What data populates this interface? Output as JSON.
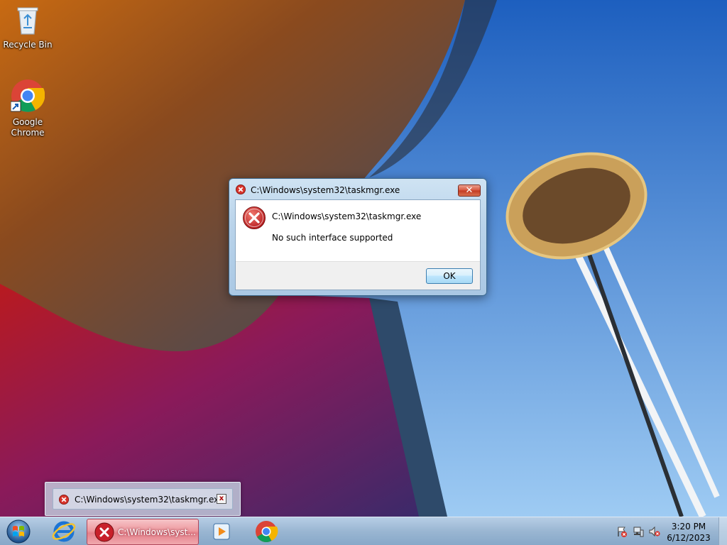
{
  "desktop": {
    "icons": [
      {
        "label": "Recycle Bin",
        "icon": "recycle-bin-icon"
      },
      {
        "label": "Google\nChrome",
        "label_line1": "Google",
        "label_line2": "Chrome",
        "icon": "chrome-icon"
      }
    ]
  },
  "dialog": {
    "title": "C:\\Windows\\system32\\taskmgr.exe",
    "close_label": "✕",
    "heading": "C:\\Windows\\system32\\taskmgr.exe",
    "message": "No such interface supported",
    "ok_label": "OK",
    "icon": "error-icon"
  },
  "peek": {
    "title": "C:\\Windows\\system32\\taskmgr.exe",
    "close_label": "x"
  },
  "taskbar": {
    "error_button_label": "C:\\Windows\\syst...",
    "items": [
      "start-orb-icon",
      "internet-explorer-icon",
      "error-icon",
      "media-player-icon",
      "chrome-icon"
    ]
  },
  "tray": {
    "time": "3:20 PM",
    "date": "6/12/2023",
    "icons": [
      "action-center-flag-icon",
      "network-icon",
      "volume-muted-icon"
    ]
  },
  "colors": {
    "error_red": "#d9342b",
    "taskbar_active": "#ee9aa0",
    "dialog_frame": "#b9d3ea"
  }
}
